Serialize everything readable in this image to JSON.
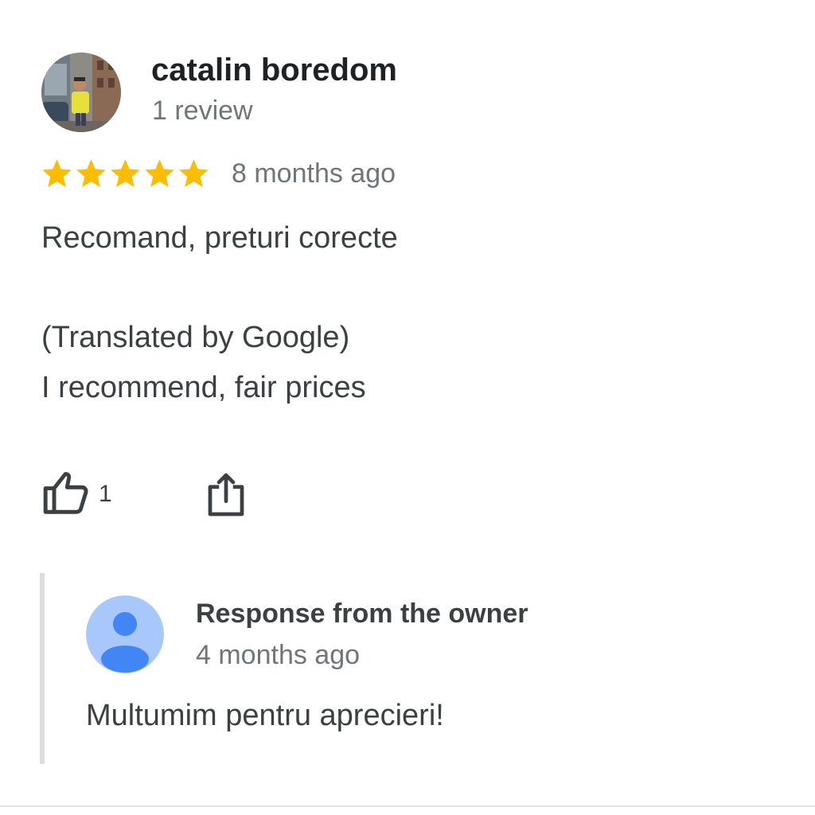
{
  "review": {
    "reviewer_name": "catalin boredom",
    "reviewer_meta": "1 review",
    "avatar": "reviewer-photo",
    "rating": 5,
    "rating_max": 5,
    "star_color": "#fbbc04",
    "date": "8 months ago",
    "text_original": "Recomand, preturi corecte",
    "translation_label": "(Translated by Google)",
    "text_translated": "I recommend, fair prices"
  },
  "actions": {
    "like_icon": "thumbs-up-icon",
    "like_count": "1",
    "share_icon": "share-icon"
  },
  "owner_response": {
    "title": "Response from the owner",
    "date": "4 months ago",
    "text": "Multumim pentru aprecieri!",
    "avatar": "person-icon",
    "avatar_bg_color": "#a8c7fa",
    "avatar_fg_color": "#4285f4"
  }
}
